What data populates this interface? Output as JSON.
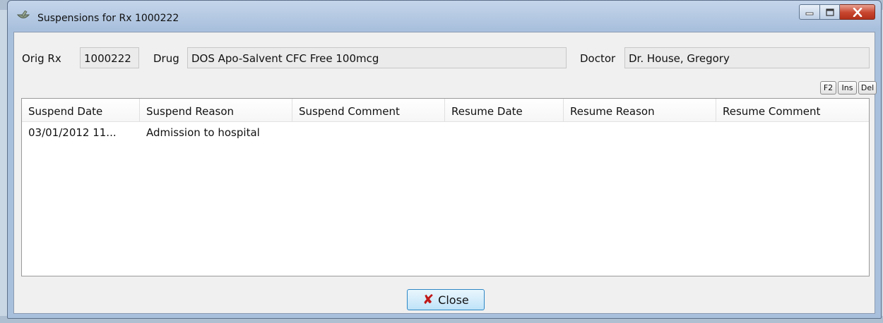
{
  "window": {
    "title": "Suspensions for Rx 1000222",
    "icon": "mortar-pestle-icon"
  },
  "header": {
    "orig_rx_label": "Orig Rx",
    "orig_rx_value": "1000222",
    "drug_label": "Drug",
    "drug_value": "DOS Apo-Salvent CFC Free 100mcg",
    "doctor_label": "Doctor",
    "doctor_value": "Dr. House, Gregory"
  },
  "shortcut_buttons": [
    "F2",
    "Ins",
    "Del"
  ],
  "table": {
    "columns": [
      "Suspend Date",
      "Suspend Reason",
      "Suspend Comment",
      "Resume Date",
      "Resume Reason",
      "Resume Comment"
    ],
    "rows": [
      [
        "03/01/2012 11...",
        "Admission to hospital",
        "",
        "",
        "",
        ""
      ]
    ]
  },
  "footer": {
    "close_label": "Close"
  },
  "colors": {
    "title_bar": "#a9c0dd",
    "close_window_button": "#c7442d",
    "close_icon": "#c01818"
  }
}
